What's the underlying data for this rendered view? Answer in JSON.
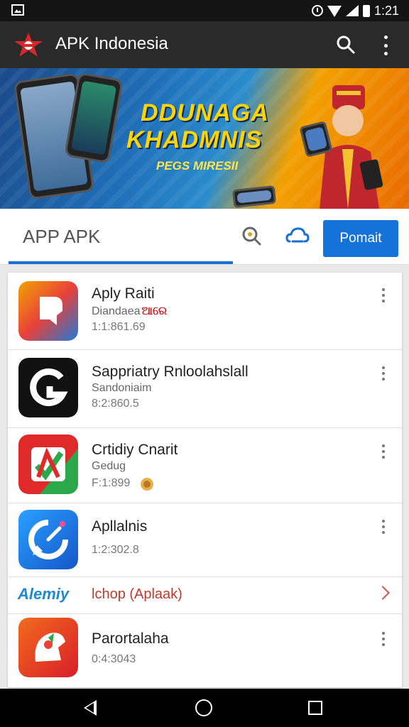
{
  "status_bar": {
    "time": "1:21",
    "icons": [
      "gallery-icon",
      "alarm-icon",
      "wifi-icon",
      "signal-icon",
      "battery-icon"
    ]
  },
  "app_bar": {
    "title": "APK Indonesia",
    "logo_icon": "red-star-logo-icon",
    "actions": [
      "search-icon",
      "more-vert-icon"
    ]
  },
  "banner": {
    "line1": "DDUNAGA",
    "line2": "KHADMNIS",
    "line3": "PEGS MIRESII",
    "colors": {
      "left": "#1f6fb8",
      "right": "#e96a00",
      "text": "#ffd400"
    }
  },
  "tab_bar": {
    "tab_label": "APP APK",
    "button_label": "Pomait",
    "accent": "#1572d6"
  },
  "apps": [
    {
      "title": "Aply Raiti",
      "subtitle": "Diandaea",
      "tag": "ଆରେ",
      "meta": "1:1:861.69"
    },
    {
      "title": "Sappriatry Rnloolahslall",
      "subtitle": "Sandoniaim",
      "meta": "8:2:860.5"
    },
    {
      "title": "Crtidiy Cnarit",
      "subtitle": "Gedug",
      "meta": "F:1:899"
    },
    {
      "title": "Apllalnis",
      "meta": "1:2:302.8"
    },
    {
      "title": "Parortalaha",
      "meta": "0:4:3043"
    }
  ],
  "promo": {
    "brand": "Alemiy",
    "label": "lchop (Aplaak)"
  },
  "nav_bar": {
    "icons": [
      "back-icon",
      "home-icon",
      "recents-icon"
    ]
  }
}
